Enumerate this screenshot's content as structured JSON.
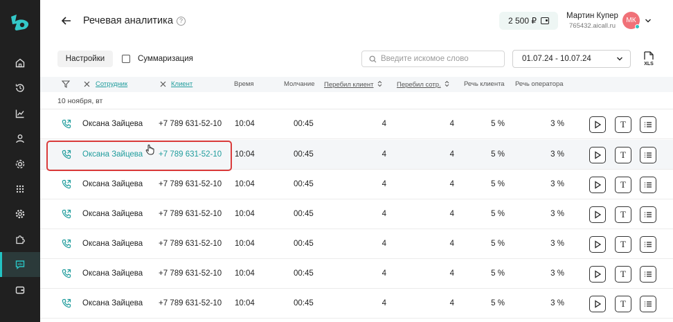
{
  "header": {
    "title": "Речевая аналитика",
    "help": "?",
    "balance": "2 500 ₽",
    "user_name": "Мартин Купер",
    "user_id": "765432.aicall.ru",
    "avatar_initials": "МК"
  },
  "toolbar": {
    "settings_label": "Настройки",
    "summary_label": "Суммаризация",
    "search_placeholder": "Введите искомое слово",
    "date_range": "01.07.24 - 10.07.24",
    "xls_label": "XLS"
  },
  "table": {
    "columns": {
      "employee": "Сотрудник",
      "client": "Клиент",
      "time": "Время",
      "silence": "Молчание",
      "client_interrupt": "Перебил клиент",
      "employee_interrupt": "Перебил сотр.",
      "client_speech": "Речь клиента",
      "operator_speech": "Речь оператора"
    },
    "group_label": "10 ноября, вт",
    "rows": [
      {
        "employee": "Оксана Зайцева",
        "client": "+7 789 631-52-10",
        "time": "10:04",
        "silence": "00:45",
        "client_interrupt": "4",
        "employee_interrupt": "4",
        "client_speech": "5 %",
        "operator_speech": "3 %"
      },
      {
        "employee": "Оксана Зайцева",
        "client": "+7 789 631-52-10",
        "time": "10:04",
        "silence": "00:45",
        "client_interrupt": "4",
        "employee_interrupt": "4",
        "client_speech": "5 %",
        "operator_speech": "3 %"
      },
      {
        "employee": "Оксана Зайцева",
        "client": "+7 789 631-52-10",
        "time": "10:04",
        "silence": "00:45",
        "client_interrupt": "4",
        "employee_interrupt": "4",
        "client_speech": "5 %",
        "operator_speech": "3 %"
      },
      {
        "employee": "Оксана Зайцева",
        "client": "+7 789 631-52-10",
        "time": "10:04",
        "silence": "00:45",
        "client_interrupt": "4",
        "employee_interrupt": "4",
        "client_speech": "5 %",
        "operator_speech": "3 %"
      },
      {
        "employee": "Оксана Зайцева",
        "client": "+7 789 631-52-10",
        "time": "10:04",
        "silence": "00:45",
        "client_interrupt": "4",
        "employee_interrupt": "4",
        "client_speech": "5 %",
        "operator_speech": "3 %"
      },
      {
        "employee": "Оксана Зайцева",
        "client": "+7 789 631-52-10",
        "time": "10:04",
        "silence": "00:45",
        "client_interrupt": "4",
        "employee_interrupt": "4",
        "client_speech": "5 %",
        "operator_speech": "3 %"
      },
      {
        "employee": "Оксана Зайцева",
        "client": "+7 789 631-52-10",
        "time": "10:04",
        "silence": "00:45",
        "client_interrupt": "4",
        "employee_interrupt": "4",
        "client_speech": "5 %",
        "operator_speech": "3 %"
      }
    ],
    "hovered_row": 1,
    "text_button": "T"
  },
  "colors": {
    "accent": "#1f9c9c",
    "sidebar_bg": "#202020",
    "highlight": "#d93a3a",
    "avatar": "#f07178"
  },
  "icons": {
    "sidebar": [
      "home-icon",
      "history-icon",
      "chart-icon",
      "user-icon",
      "integration-icon",
      "grid-icon",
      "gear-icon",
      "puzzle-icon",
      "speech-analytics-icon",
      "wallet-icon"
    ],
    "actions": [
      "play-icon",
      "text-icon",
      "list-icon"
    ],
    "row": "phone-call-icon"
  }
}
